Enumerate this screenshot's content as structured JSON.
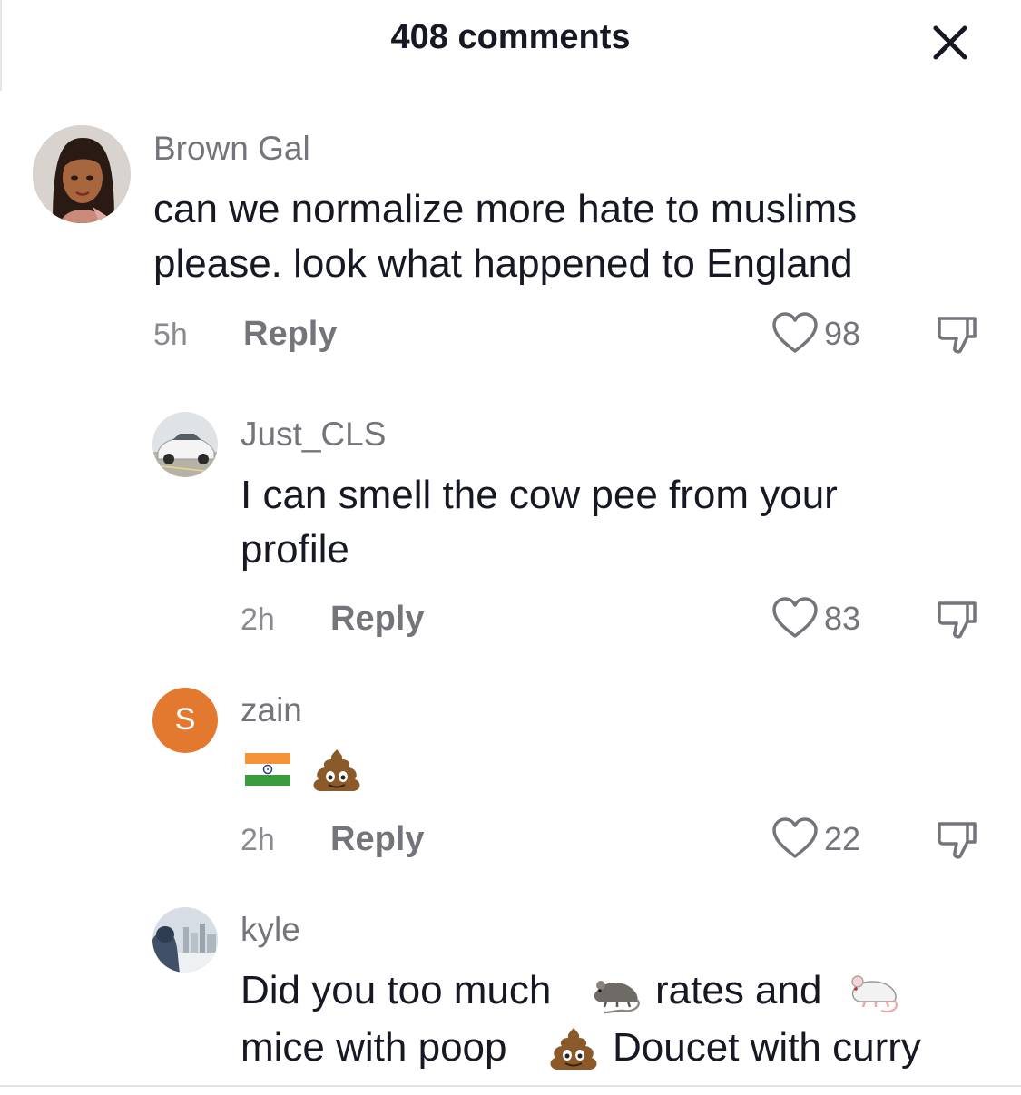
{
  "header": {
    "title": "408 comments",
    "close_icon": "close-icon"
  },
  "comments": [
    {
      "username": "Brown Gal",
      "avatar": "illustrated-woman-avatar",
      "text_line1": "can we normalize more hate to muslims",
      "text_line2": "please. look what happened to England",
      "time": "5h",
      "reply_label": "Reply",
      "likes": "98"
    },
    {
      "username": "Just_CLS",
      "avatar": "white-car-photo-avatar",
      "text_line1": "I can smell the cow pee from your",
      "text_line2": "profile",
      "time": "2h",
      "reply_label": "Reply",
      "likes": "83"
    },
    {
      "username": "zain",
      "avatar_letter": "S",
      "avatar_color": "#e3782f",
      "emojis": [
        "india-flag-emoji",
        "pile-of-poo-emoji"
      ],
      "time": "2h",
      "reply_label": "Reply",
      "likes": "22"
    },
    {
      "username": "kyle",
      "avatar": "city-winter-photo-avatar",
      "text_part1": "Did you too much",
      "text_part2": "rates and",
      "text_part3": "mice with poop",
      "text_part4": "Doucet with curry",
      "emojis": [
        "rat-emoji",
        "mouse-emoji",
        "pile-of-poo-emoji"
      ]
    }
  ],
  "colors": {
    "text_primary": "#161823",
    "text_secondary": "#73757b",
    "avatar_orange": "#e3782f"
  }
}
